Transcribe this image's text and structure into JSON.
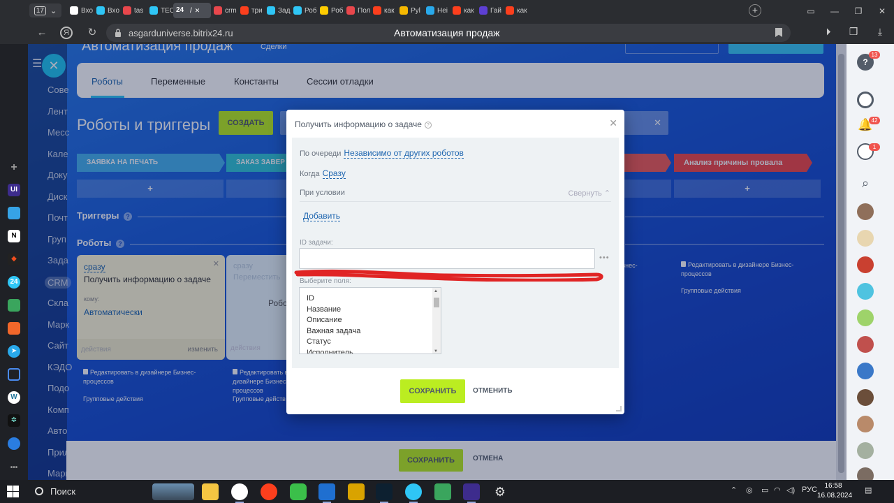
{
  "browser": {
    "tab_count": "17",
    "tabs": [
      {
        "label": "Вхо",
        "color": "#ffffff"
      },
      {
        "label": "Вхо",
        "color": "#2fc6f6"
      },
      {
        "label": "tas",
        "color": "#e8474c"
      },
      {
        "label": "TEC",
        "color": "#2fc6f6"
      },
      {
        "label": "/",
        "color": "#2fc6f6"
      },
      {
        "label": "crm",
        "color": "#e8474c"
      },
      {
        "label": "три",
        "color": "#fc3f1d"
      },
      {
        "label": "Зад",
        "color": "#2fc6f6"
      },
      {
        "label": "Роб",
        "color": "#2fc6f6"
      },
      {
        "label": "Роб",
        "color": "#ffcc00"
      },
      {
        "label": "Пол",
        "color": "#e8474c"
      },
      {
        "label": "как",
        "color": "#fc3f1d"
      },
      {
        "label": "Pyl",
        "color": "#f5b800"
      },
      {
        "label": "Неі",
        "color": "#29a9eb"
      },
      {
        "label": "как",
        "color": "#fc3f1d"
      },
      {
        "label": "Гай",
        "color": "#5d3fd3"
      },
      {
        "label": "как",
        "color": "#fc3f1d"
      }
    ],
    "active_tab_index": 4,
    "active_tab_icon": "24",
    "url": "asgarduniverse.bitrix24.ru",
    "page_title": "Автоматизация продаж"
  },
  "app": {
    "header_title": "Автоматизация продаж",
    "header_sub": "Сделки",
    "left_menu": [
      "Сове",
      "Лент",
      "Месс",
      "Кале",
      "Доку",
      "Диск",
      "Почт",
      "Груп",
      "Зада",
      "CRM",
      "Скла",
      "Марк",
      "Сайт",
      "КЭДО",
      "Подо",
      "Комп",
      "Авто",
      "Прил",
      "Марк"
    ],
    "tabs": [
      "Роботы",
      "Переменные",
      "Константы",
      "Сессии отладки"
    ],
    "section_title": "Роботы и триггеры",
    "create_label": "СОЗДАТЬ",
    "stages": [
      {
        "label": "ЗАЯВКА НА ПЕЧАТЬ",
        "color": "#47b2ee"
      },
      {
        "label": "ЗАКАЗ ЗАВЕР",
        "color": "#33c6d8"
      },
      {
        "label": "",
        "color": "#f25c58"
      },
      {
        "label": "Анализ причины провала",
        "color": "#f24949"
      }
    ],
    "plus_label": "+",
    "triggers_label": "Триггеры",
    "robots_label": "Роботы",
    "help_glyph": "?",
    "robot_card": {
      "when": "сразу",
      "name": "Получить информацию о задаче",
      "to_label": "кому:",
      "assignee": "Автоматически",
      "actions_label": "действия",
      "edit_label": "изменить"
    },
    "robot_card2": {
      "when": "сразу",
      "name": "Переместить",
      "center": "Робо",
      "actions_label": "действия"
    },
    "edit_designer": "Редактировать в дизайнере Бизнес-процессов",
    "group_actions": "Групповые действия",
    "right_col_fragment": "знес-",
    "save_label": "СОХРАНИТЬ",
    "cancel_label": "ОТМЕНА"
  },
  "modal": {
    "title": "Получить информацию о задаче",
    "queue_label": "По очереди",
    "queue_value": "Независимо от других роботов",
    "when_label": "Когда",
    "when_value": "Сразу",
    "condition_label": "При условии",
    "collapse_label": "Свернуть",
    "add_label": "Добавить",
    "task_id_label": "ID задачи:",
    "task_id_value": "",
    "dots_label": "•••",
    "fields_label": "Выберите поля:",
    "field_options": [
      "ID",
      "Название",
      "Описание",
      "Важная задача",
      "Статус",
      "Исполнитель"
    ],
    "save_label": "СОХРАНИТЬ",
    "cancel_label": "ОТМЕНИТЬ"
  },
  "right_rail": {
    "badges": [
      "13",
      "42",
      "1"
    ]
  },
  "taskbar": {
    "search_label": "Поиск",
    "lang": "РУС",
    "time": "16:58",
    "date": "16.08.2024"
  },
  "colors": {
    "accent_green": "#bbed21",
    "link_blue": "#2067b0",
    "red_annotation": "#e02424"
  }
}
